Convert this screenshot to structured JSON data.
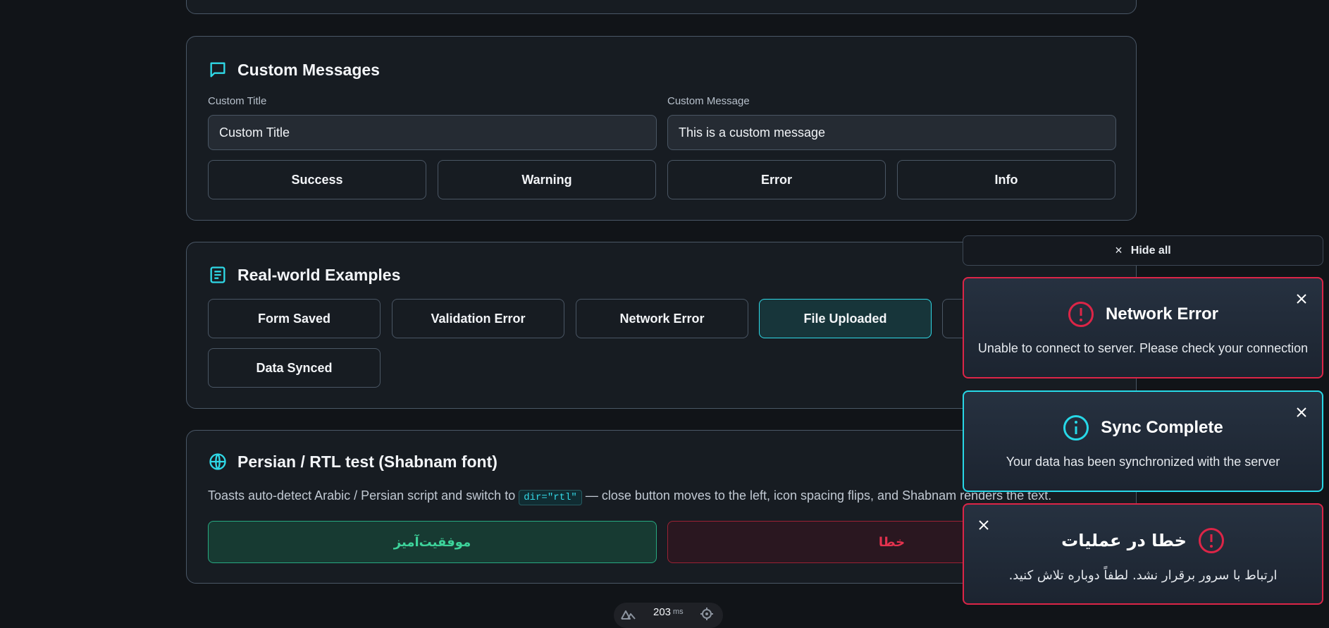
{
  "custom": {
    "title": "Custom Messages",
    "title_label": "Custom Title",
    "title_value": "Custom Title",
    "message_label": "Custom Message",
    "message_value": "This is a custom message",
    "buttons": [
      "Success",
      "Warning",
      "Error",
      "Info"
    ],
    "icon": "message-square-icon"
  },
  "examples": {
    "title": "Real-world Examples",
    "icon": "list-document-icon",
    "buttons": [
      "Form Saved",
      "Validation Error",
      "Network Error",
      "File Uploaded",
      "Data Synced"
    ]
  },
  "rtl": {
    "title": "Persian / RTL test (Shabnam font)",
    "icon": "globe-icon",
    "description_before": "Toasts auto-detect Arabic / Persian script and switch to ",
    "code": "dir=\"rtl\"",
    "description_after": " — close button moves to the left, icon spacing flips, and Shabnam renders the text.",
    "success_button": "موفقیت‌آمیز",
    "error_button": "خطا"
  },
  "toasts": {
    "hide_all": "Hide all",
    "items": [
      {
        "title": "Network Error",
        "message": "Unable to connect to server. Please check your connection",
        "type": "error",
        "icon": "alert-circle-icon"
      },
      {
        "title": "Sync Complete",
        "message": "Your data has been synchronized with the server",
        "type": "info",
        "icon": "info-circle-icon"
      },
      {
        "title": "خطا در عملیات",
        "message": "ارتباط با سرور برقرار نشد. لطفاً دوباره تلاش کنید.",
        "type": "error",
        "icon": "alert-circle-icon"
      }
    ]
  },
  "status": {
    "timing": "203",
    "unit": "ms",
    "icon": "nuxt-icon",
    "locator_icon": "target-icon"
  },
  "colors": {
    "accent": "#2fd9e7",
    "error": "#dc2547",
    "success": "#3dd29a",
    "background": "#111418"
  }
}
